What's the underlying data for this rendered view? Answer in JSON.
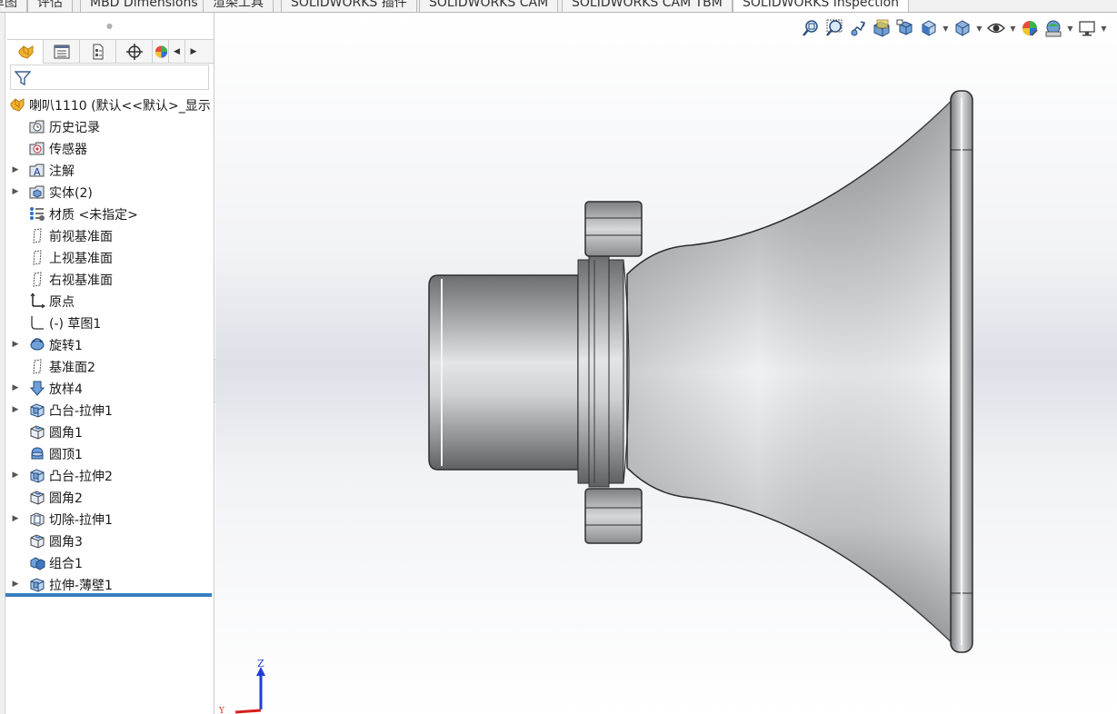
{
  "tabs": [
    {
      "label": "草图",
      "active": false
    },
    {
      "label": "评估",
      "active": false
    },
    {
      "label": "MBD Dimensions",
      "active": false
    },
    {
      "label": "渲染工具",
      "active": false
    },
    {
      "label": "SOLIDWORKS 插件",
      "active": false
    },
    {
      "label": "SOLIDWORKS CAM",
      "active": false
    },
    {
      "label": "SOLIDWORKS CAM TBM",
      "active": false
    },
    {
      "label": "SOLIDWORKS Inspection",
      "active": true
    }
  ],
  "panel_tabs": [
    {
      "icon": "feature-manager-icon"
    },
    {
      "icon": "property-manager-icon"
    },
    {
      "icon": "configuration-manager-icon"
    },
    {
      "icon": "dimxpert-manager-icon"
    },
    {
      "icon": "display-manager-icon"
    }
  ],
  "filter": {
    "icon": "filter-icon"
  },
  "tree": {
    "root": {
      "label": "喇叭1110  (默认<<默认>_显示",
      "icon": "part-icon"
    },
    "items": [
      {
        "label": "历史记录",
        "icon": "history-folder-icon",
        "expandable": false
      },
      {
        "label": "传感器",
        "icon": "sensor-folder-icon",
        "expandable": false
      },
      {
        "label": "注解",
        "icon": "annotations-folder-icon",
        "expandable": true
      },
      {
        "label": "实体(2)",
        "icon": "solid-bodies-folder-icon",
        "expandable": true
      },
      {
        "label": "材质 <未指定>",
        "icon": "material-icon",
        "expandable": false
      },
      {
        "label": "前视基准面",
        "icon": "plane-icon",
        "expandable": false
      },
      {
        "label": "上视基准面",
        "icon": "plane-icon",
        "expandable": false
      },
      {
        "label": "右视基准面",
        "icon": "plane-icon",
        "expandable": false
      },
      {
        "label": "原点",
        "icon": "origin-icon",
        "expandable": false
      },
      {
        "label": "(-) 草图1",
        "icon": "sketch-icon",
        "expandable": false
      },
      {
        "label": "旋转1",
        "icon": "revolve-icon",
        "expandable": true
      },
      {
        "label": "基准面2",
        "icon": "plane-icon",
        "expandable": false
      },
      {
        "label": "放样4",
        "icon": "loft-icon",
        "expandable": true
      },
      {
        "label": "凸台-拉伸1",
        "icon": "boss-extrude-icon",
        "expandable": true
      },
      {
        "label": "圆角1",
        "icon": "fillet-icon",
        "expandable": false
      },
      {
        "label": "圆顶1",
        "icon": "dome-icon",
        "expandable": false
      },
      {
        "label": "凸台-拉伸2",
        "icon": "boss-extrude-icon",
        "expandable": true
      },
      {
        "label": "圆角2",
        "icon": "fillet-icon",
        "expandable": false
      },
      {
        "label": "切除-拉伸1",
        "icon": "cut-extrude-icon",
        "expandable": true
      },
      {
        "label": "圆角3",
        "icon": "fillet-icon",
        "expandable": false
      },
      {
        "label": "组合1",
        "icon": "combine-icon",
        "expandable": false
      },
      {
        "label": "拉伸-薄壁1",
        "icon": "boss-extrude-icon",
        "expandable": true
      }
    ]
  },
  "hud": [
    {
      "icon": "zoom-to-fit-icon",
      "dropdown": false
    },
    {
      "icon": "zoom-to-area-icon",
      "dropdown": false
    },
    {
      "icon": "previous-view-icon",
      "dropdown": false
    },
    {
      "icon": "section-view-icon",
      "dropdown": false
    },
    {
      "icon": "dynamic-annotation-view-icon",
      "dropdown": false
    },
    {
      "icon": "view-orientation-icon",
      "dropdown": true
    },
    {
      "icon": "display-style-icon",
      "dropdown": true
    },
    {
      "icon": "hide-show-items-icon",
      "dropdown": true
    },
    {
      "icon": "edit-appearance-icon",
      "dropdown": false
    },
    {
      "icon": "apply-scene-icon",
      "dropdown": true
    },
    {
      "icon": "view-settings-icon",
      "dropdown": true
    }
  ],
  "triad": {
    "z_label": "Z",
    "y_label": "Y"
  },
  "colors": {
    "accent": "#3a7fc1",
    "triad_z": "#1f3fd6",
    "triad_x": "#d62020"
  },
  "model": {
    "name": "喇叭1110"
  }
}
